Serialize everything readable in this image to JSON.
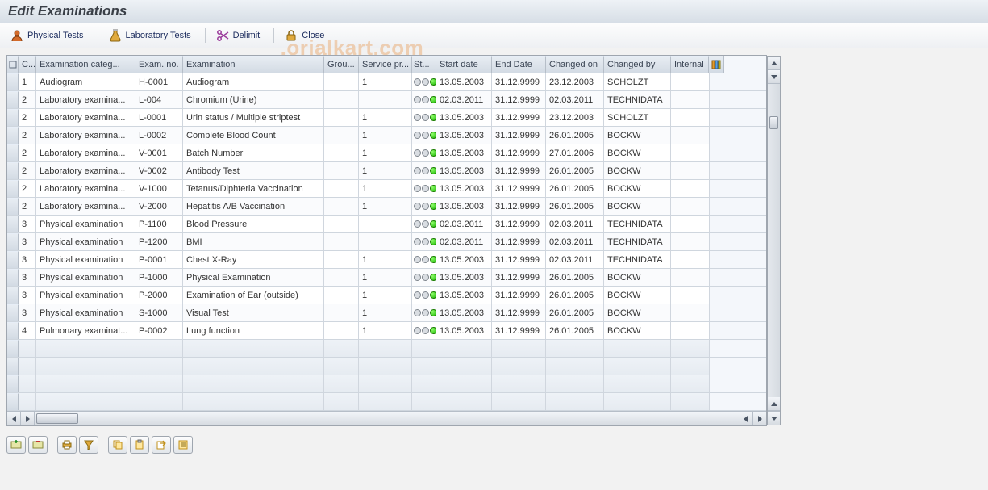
{
  "title": "Edit Examinations",
  "toolbar": {
    "physical": "Physical Tests",
    "laboratory": "Laboratory Tests",
    "delimit": "Delimit",
    "close": "Close"
  },
  "watermark": "_ .orialkart.com",
  "columns": {
    "c": "C...",
    "cat": "Examination categ...",
    "exno": "Exam. no.",
    "exam": "Examination",
    "grp": "Grou...",
    "srv": "Service pr...",
    "st": "St...",
    "sd": "Start date",
    "ed": "End Date",
    "co": "Changed on",
    "cb": "Changed by",
    "int": "Internal"
  },
  "rows": [
    {
      "c": "1",
      "cat": "Audiogram",
      "exno": "H-0001",
      "exam": "Audiogram",
      "grp": "",
      "srv": "1",
      "sd": "13.05.2003",
      "ed": "31.12.9999",
      "co": "23.12.2003",
      "cb": "SCHOLZT",
      "int": ""
    },
    {
      "c": "2",
      "cat": "Laboratory examina...",
      "exno": "L-004",
      "exam": "Chromium (Urine)",
      "grp": "",
      "srv": "",
      "sd": "02.03.2011",
      "ed": "31.12.9999",
      "co": "02.03.2011",
      "cb": "TECHNIDATA",
      "int": ""
    },
    {
      "c": "2",
      "cat": "Laboratory examina...",
      "exno": "L-0001",
      "exam": "Urin status / Multiple striptest",
      "grp": "",
      "srv": "1",
      "sd": "13.05.2003",
      "ed": "31.12.9999",
      "co": "23.12.2003",
      "cb": "SCHOLZT",
      "int": ""
    },
    {
      "c": "2",
      "cat": "Laboratory examina...",
      "exno": "L-0002",
      "exam": "Complete Blood Count",
      "grp": "",
      "srv": "1",
      "sd": "13.05.2003",
      "ed": "31.12.9999",
      "co": "26.01.2005",
      "cb": "BOCKW",
      "int": ""
    },
    {
      "c": "2",
      "cat": "Laboratory examina...",
      "exno": "V-0001",
      "exam": "Batch Number",
      "grp": "",
      "srv": "1",
      "sd": "13.05.2003",
      "ed": "31.12.9999",
      "co": "27.01.2006",
      "cb": "BOCKW",
      "int": ""
    },
    {
      "c": "2",
      "cat": "Laboratory examina...",
      "exno": "V-0002",
      "exam": "Antibody Test",
      "grp": "",
      "srv": "1",
      "sd": "13.05.2003",
      "ed": "31.12.9999",
      "co": "26.01.2005",
      "cb": "BOCKW",
      "int": ""
    },
    {
      "c": "2",
      "cat": "Laboratory examina...",
      "exno": "V-1000",
      "exam": "Tetanus/Diphteria Vaccination",
      "grp": "",
      "srv": "1",
      "sd": "13.05.2003",
      "ed": "31.12.9999",
      "co": "26.01.2005",
      "cb": "BOCKW",
      "int": ""
    },
    {
      "c": "2",
      "cat": "Laboratory examina...",
      "exno": "V-2000",
      "exam": "Hepatitis A/B Vaccination",
      "grp": "",
      "srv": "1",
      "sd": "13.05.2003",
      "ed": "31.12.9999",
      "co": "26.01.2005",
      "cb": "BOCKW",
      "int": ""
    },
    {
      "c": "3",
      "cat": "Physical examination",
      "exno": "P-1100",
      "exam": "Blood Pressure",
      "grp": "",
      "srv": "",
      "sd": "02.03.2011",
      "ed": "31.12.9999",
      "co": "02.03.2011",
      "cb": "TECHNIDATA",
      "int": ""
    },
    {
      "c": "3",
      "cat": "Physical examination",
      "exno": "P-1200",
      "exam": "BMI",
      "grp": "",
      "srv": "",
      "sd": "02.03.2011",
      "ed": "31.12.9999",
      "co": "02.03.2011",
      "cb": "TECHNIDATA",
      "int": ""
    },
    {
      "c": "3",
      "cat": "Physical examination",
      "exno": "P-0001",
      "exam": "Chest X-Ray",
      "grp": "",
      "srv": "1",
      "sd": "13.05.2003",
      "ed": "31.12.9999",
      "co": "02.03.2011",
      "cb": "TECHNIDATA",
      "int": ""
    },
    {
      "c": "3",
      "cat": "Physical examination",
      "exno": "P-1000",
      "exam": "Physical Examination",
      "grp": "",
      "srv": "1",
      "sd": "13.05.2003",
      "ed": "31.12.9999",
      "co": "26.01.2005",
      "cb": "BOCKW",
      "int": ""
    },
    {
      "c": "3",
      "cat": "Physical examination",
      "exno": "P-2000",
      "exam": "Examination of Ear (outside)",
      "grp": "",
      "srv": "1",
      "sd": "13.05.2003",
      "ed": "31.12.9999",
      "co": "26.01.2005",
      "cb": "BOCKW",
      "int": ""
    },
    {
      "c": "3",
      "cat": "Physical examination",
      "exno": "S-1000",
      "exam": "Visual Test",
      "grp": "",
      "srv": "1",
      "sd": "13.05.2003",
      "ed": "31.12.9999",
      "co": "26.01.2005",
      "cb": "BOCKW",
      "int": ""
    },
    {
      "c": "4",
      "cat": "Pulmonary examinat...",
      "exno": "P-0002",
      "exam": "Lung function",
      "grp": "",
      "srv": "1",
      "sd": "13.05.2003",
      "ed": "31.12.9999",
      "co": "26.01.2005",
      "cb": "BOCKW",
      "int": ""
    }
  ],
  "empty_rows": 4
}
